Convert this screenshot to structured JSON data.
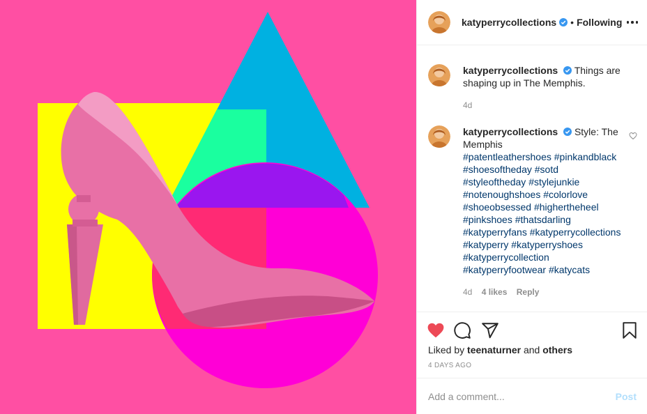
{
  "media": {
    "colors": {
      "background": "#ff4fa3",
      "yellow_square": "#ffff00",
      "triangle": "#00b1e1",
      "triangle_overlap": "#1aff9f",
      "circle": "#ff00d6",
      "circle_overlap_triangle": "#9a16ef",
      "circle_overlap_square": "#ff2a74",
      "shoe": "#e870a6"
    }
  },
  "header": {
    "username": "katyperrycollections",
    "separator": "•",
    "follow_status": "Following",
    "verified_icon": "verified-badge-icon",
    "more_icon": "more-options-icon"
  },
  "comments": [
    {
      "username": "katyperrycollections",
      "text": "Things are shaping up in The Memphis.",
      "time": "4d"
    },
    {
      "username": "katyperrycollections",
      "text": "Style: The Memphis",
      "hashtags": [
        "#patentleathershoes",
        "#pinkandblack",
        "#shoesoftheday",
        "#sotd",
        "#styleoftheday",
        "#stylejunkie",
        "#notenoughshoes",
        "#colorlove",
        "#shoeobsessed",
        "#highertheheel",
        "#pinkshoes",
        "#thatsdarling",
        "#katyperryfans",
        "#katyperrycollections",
        "#katyperry",
        "#katyperryshoes",
        "#katyperrycollection",
        "#katyperryfootwear",
        "#katycats"
      ],
      "time": "4d",
      "likes": "4 likes",
      "reply": "Reply"
    }
  ],
  "actions": {
    "icons": [
      "heart-filled-icon",
      "comment-icon",
      "share-icon",
      "bookmark-icon"
    ],
    "heart_color": "#ed4956",
    "liked_by_prefix": "Liked by",
    "liked_by_user": "teenaturner",
    "liked_by_and": "and",
    "liked_by_others": "others",
    "date": "4 DAYS AGO"
  },
  "add_comment": {
    "placeholder": "Add a comment...",
    "post_label": "Post"
  }
}
